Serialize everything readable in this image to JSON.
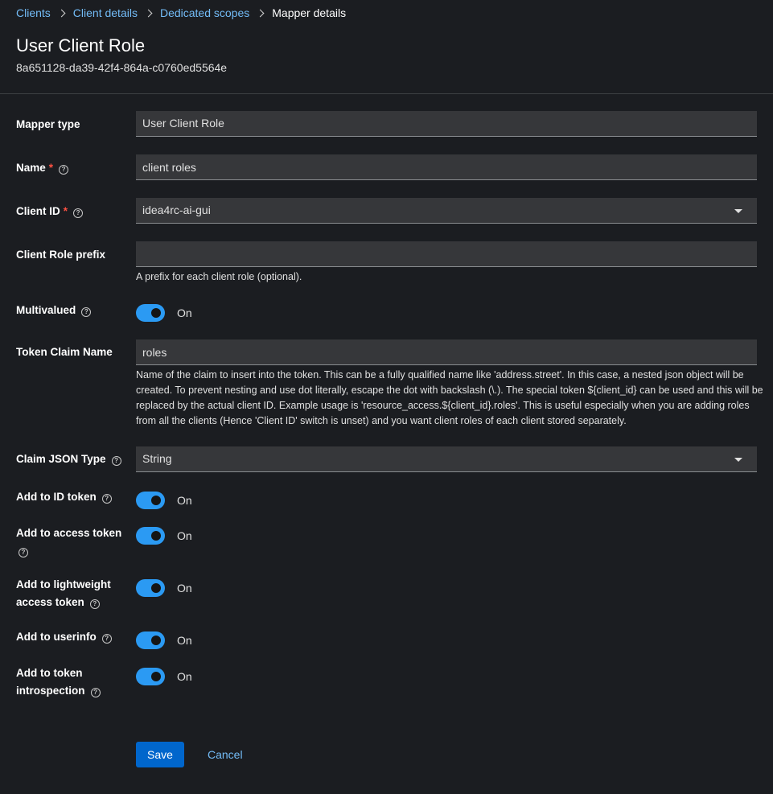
{
  "breadcrumb": {
    "items": [
      "Clients",
      "Client details",
      "Dedicated scopes"
    ],
    "current": "Mapper details"
  },
  "header": {
    "title": "User Client Role",
    "subtitle": "8a651128-da39-42f4-864a-c0760ed5564e"
  },
  "form": {
    "mapper_type": {
      "label": "Mapper type",
      "value": "User Client Role"
    },
    "name": {
      "label": "Name",
      "required_mark": "*",
      "value": "client roles"
    },
    "client_id": {
      "label": "Client ID",
      "required_mark": "*",
      "value": "idea4rc-ai-gui"
    },
    "client_role_prefix": {
      "label": "Client Role prefix",
      "value": "",
      "helper": "A prefix for each client role (optional)."
    },
    "multivalued": {
      "label": "Multivalued",
      "state": "On",
      "on": true
    },
    "token_claim_name": {
      "label": "Token Claim Name",
      "value": "roles",
      "helper": "Name of the claim to insert into the token. This can be a fully qualified name like 'address.street'. In this case, a nested json object will be created. To prevent nesting and use dot literally, escape the dot with backslash (\\.). The special token ${client_id} can be used and this will be replaced by the actual client ID. Example usage is 'resource_access.${client_id}.roles'. This is useful especially when you are adding roles from all the clients (Hence 'Client ID' switch is unset) and you want client roles of each client stored separately."
    },
    "claim_json_type": {
      "label": "Claim JSON Type",
      "value": "String"
    },
    "add_to_id_token": {
      "label": "Add to ID token",
      "state": "On",
      "on": true
    },
    "add_to_access_token": {
      "label_line1": "Add to access token",
      "state": "On",
      "on": true
    },
    "add_to_lightweight_access_token": {
      "label_line1": "Add to lightweight",
      "label_line2": "access token",
      "state": "On",
      "on": true
    },
    "add_to_userinfo": {
      "label": "Add to userinfo",
      "state": "On",
      "on": true
    },
    "add_to_token_introspection": {
      "label_line1": "Add to token",
      "label_line2": "introspection",
      "state": "On",
      "on": true
    }
  },
  "actions": {
    "save_label": "Save",
    "cancel_label": "Cancel"
  },
  "colors": {
    "background": "#1b1d21",
    "field_bg": "#36373a",
    "link": "#73bcf7",
    "primary": "#0066cc",
    "toggle_on": "#2b9af3",
    "required": "#fe5142"
  }
}
